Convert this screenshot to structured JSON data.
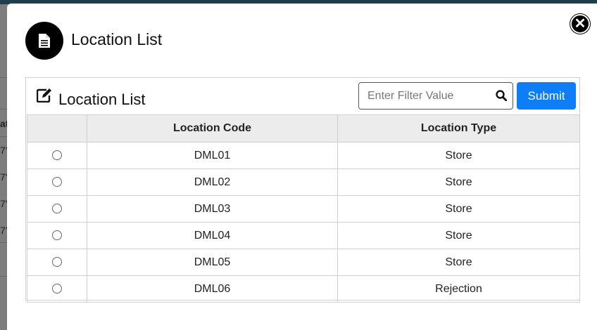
{
  "background": {
    "row_fragments": [
      "at",
      "7'",
      "7'",
      "7'",
      "7'"
    ]
  },
  "modal": {
    "title": "Location List",
    "title_icon": "document-icon",
    "close_icon": "close-icon"
  },
  "panel": {
    "title": "Location List",
    "title_icon": "edit-icon",
    "filter": {
      "placeholder": "Enter Filter Value",
      "value": ""
    },
    "submit_label": "Submit"
  },
  "table": {
    "columns": [
      "",
      "Location Code",
      "Location Type"
    ],
    "rows": [
      {
        "code": "DML01",
        "type": "Store"
      },
      {
        "code": "DML02",
        "type": "Store"
      },
      {
        "code": "DML03",
        "type": "Store"
      },
      {
        "code": "DML04",
        "type": "Store"
      },
      {
        "code": "DML05",
        "type": "Store"
      },
      {
        "code": "DML06",
        "type": "Rejection"
      }
    ]
  },
  "colors": {
    "accent": "#0d7ef5",
    "header_bg": "#ececec"
  }
}
